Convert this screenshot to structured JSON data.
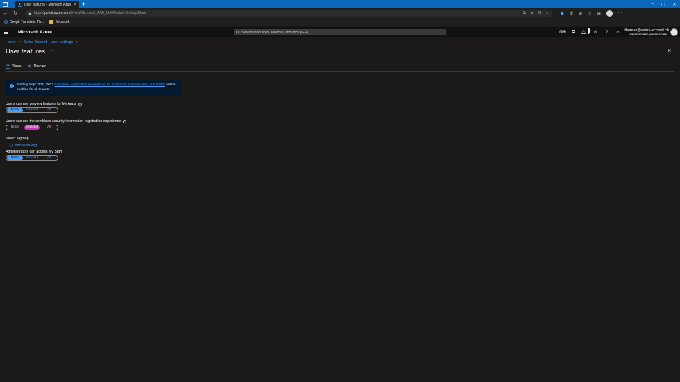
{
  "browser": {
    "tab_title": "User features - Microsoft Azure",
    "new_tab": "+",
    "url_prefix": "https://",
    "url_host": "portal.azure.com",
    "url_path": "/#view/Microsoft_AAD_IAM/FeatureSettingsBlade",
    "favorites": [
      {
        "label": "DeepL Translate: Th..."
      },
      {
        "label": "Microsoft"
      }
    ]
  },
  "azure": {
    "brand": "Microsoft Azure",
    "search_placeholder": "Search resources, services, and docs (G+/)",
    "notification_count": "1",
    "user_email": "thomas@swiss-schmid.ch",
    "user_tenant": "SWISS-SCHMID (SWISS-SCHMI..."
  },
  "breadcrumb": {
    "home": "Home",
    "sep1": ">",
    "tenant": "Swiss-Schmid | User settings",
    "sep2": ">"
  },
  "page": {
    "title": "User features",
    "more": "···",
    "close": "✕"
  },
  "toolbar": {
    "save": "Save",
    "discard": "Discard"
  },
  "info": {
    "prefix": "Starting Sept. 30th, 2022",
    "link": "Combined registration experiences for multifactor authentication and SSPR",
    "suffix": "will be enabled for all tenants."
  },
  "settings": {
    "preview": {
      "label": "Users can use preview features for My Apps",
      "options": [
        "None",
        "Selected",
        "All"
      ],
      "selected": "None"
    },
    "combined": {
      "label": "Users can use the combined security information registration experience",
      "options": [
        "None",
        "Selected",
        "All"
      ],
      "selected": "Selected"
    },
    "group": {
      "label": "Select a group",
      "value": "G_ComSecInfReg"
    },
    "mystaff": {
      "label": "Administrators can access My Staff",
      "options": [
        "None",
        "Selected",
        "All"
      ],
      "selected": "None"
    }
  },
  "colors": {
    "accent": "#479ef5",
    "selected_pink": "#c239b3",
    "background": "#1b1a19",
    "tabbar": "#0a68bd"
  }
}
